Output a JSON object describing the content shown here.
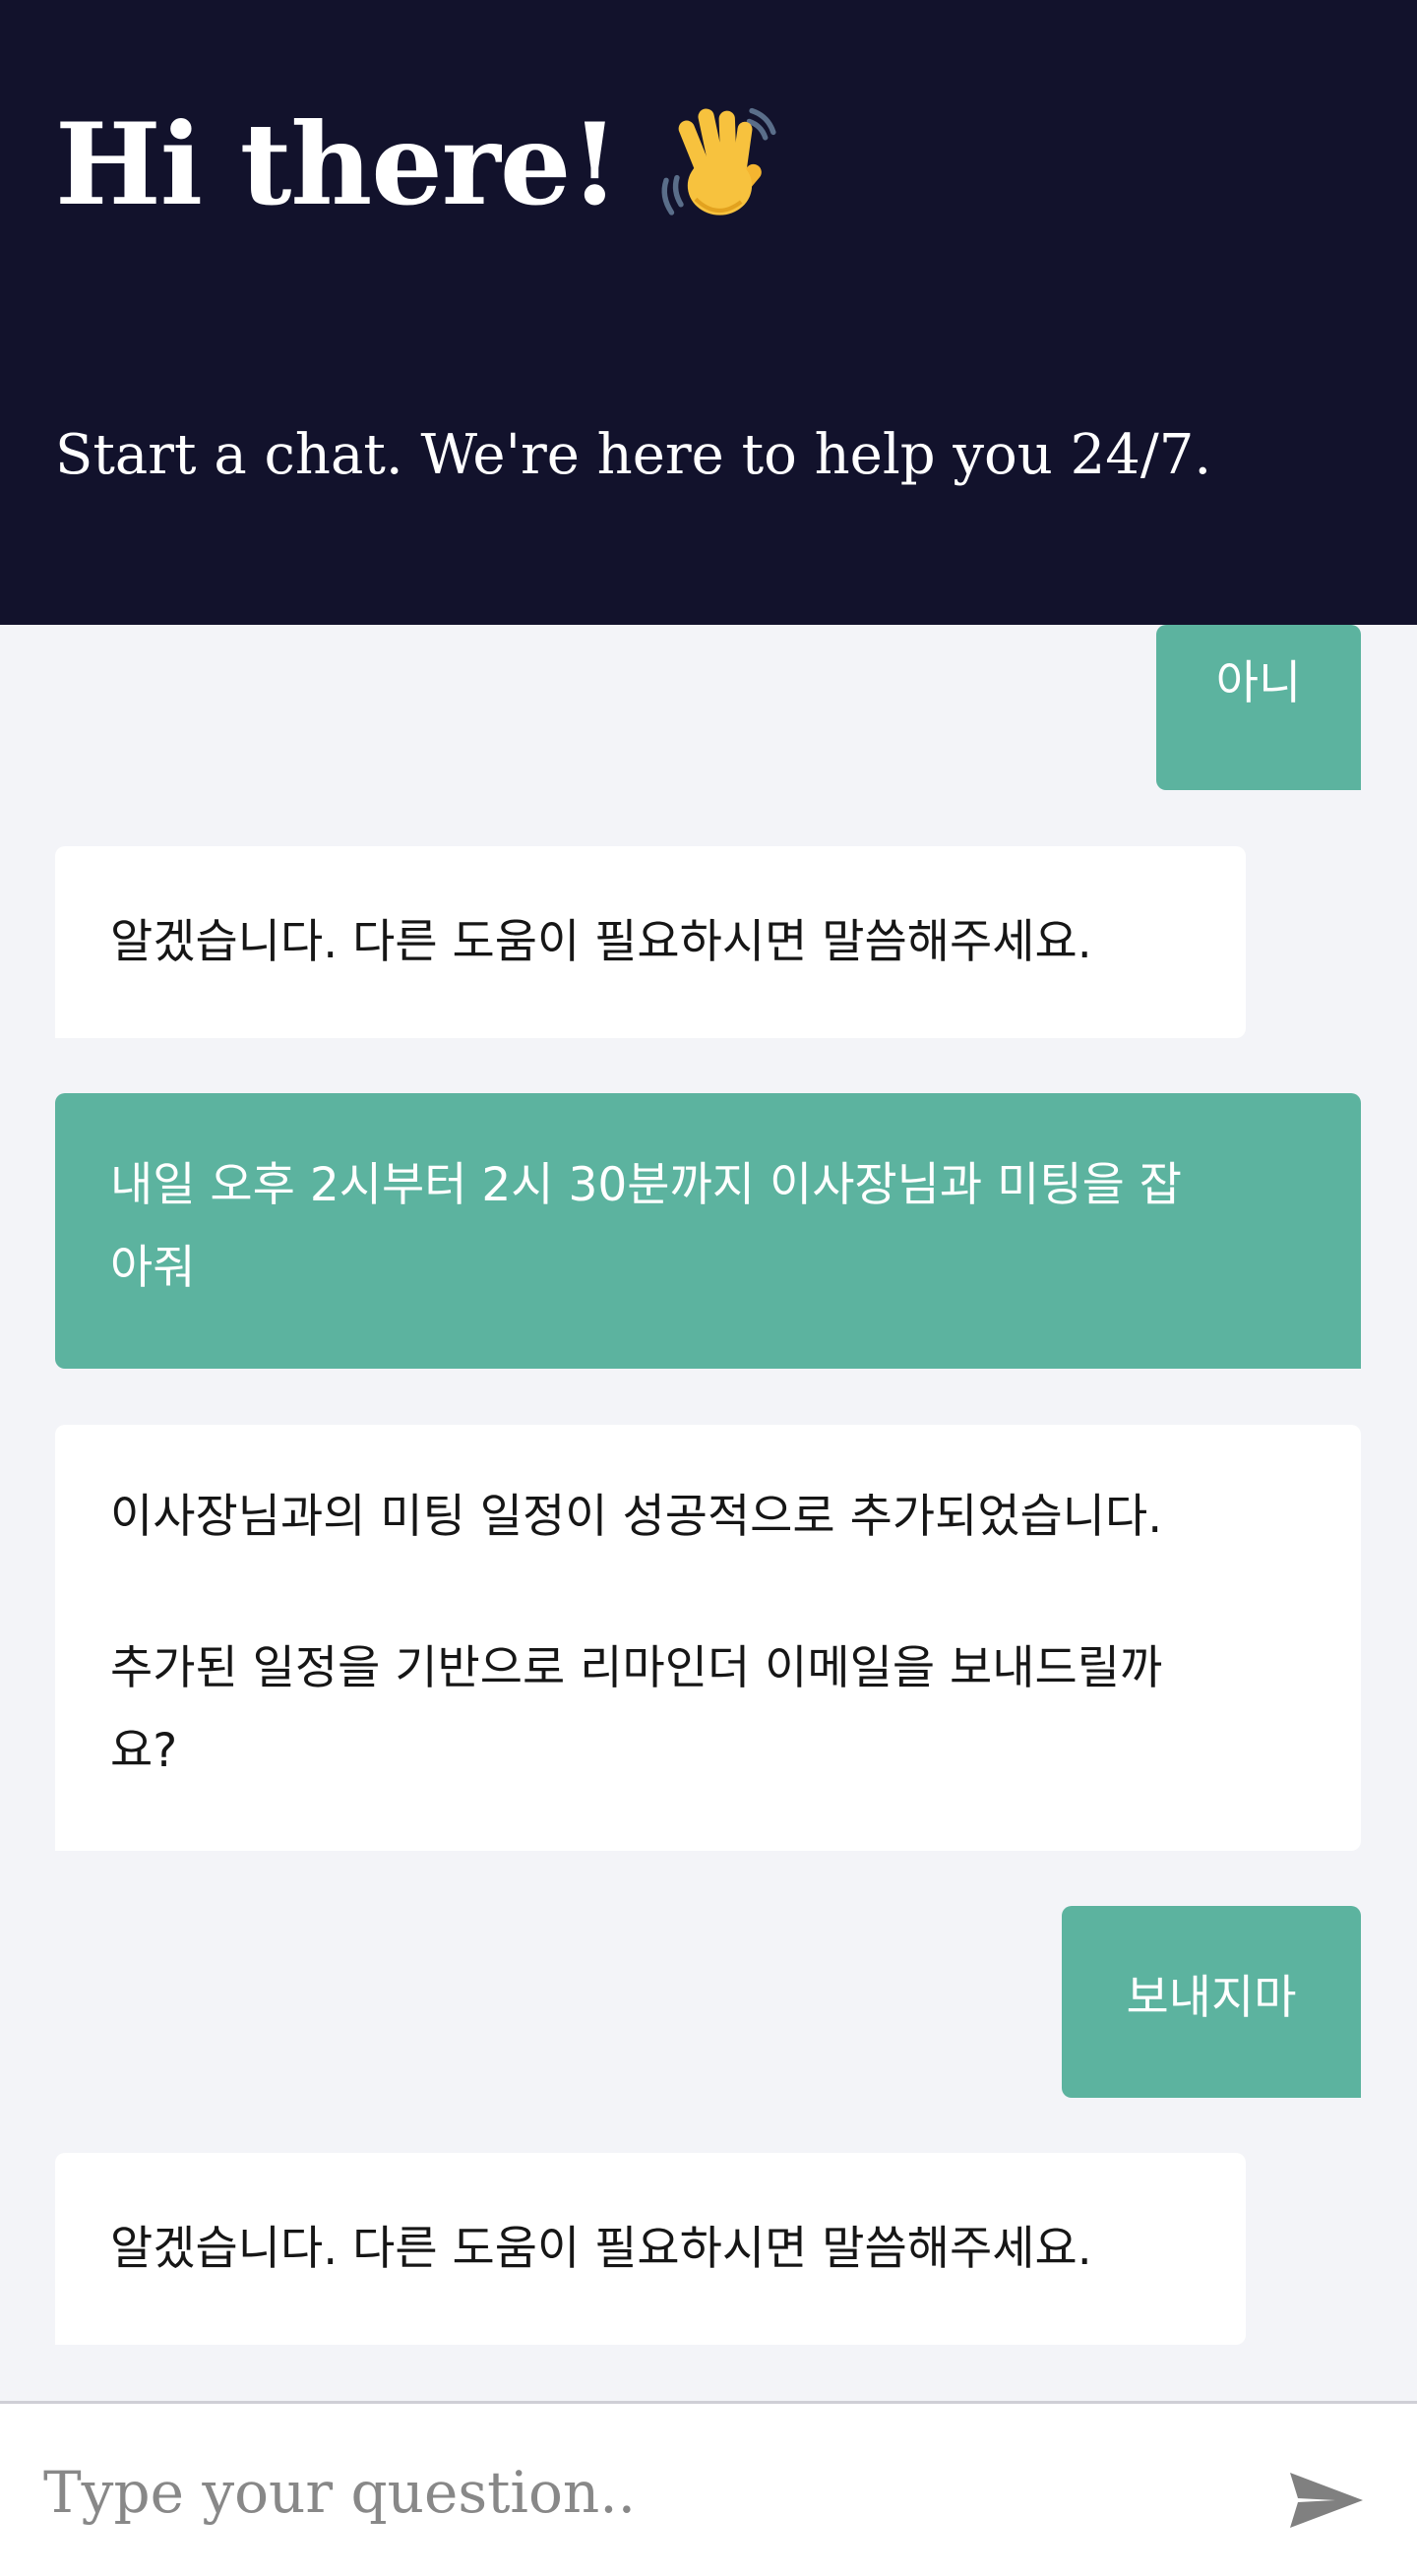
{
  "header": {
    "greeting": "Hi there!",
    "tagline": "Start a chat. We're here to help you 24/7.",
    "wave_icon": "waving-hand-icon",
    "background_color": "#12122c"
  },
  "colors": {
    "user_bubble": "#5cb39f",
    "bot_bubble": "#ffffff",
    "chat_background": "#f3f4f8"
  },
  "messages": [
    {
      "sender": "user",
      "lines": [
        "아니"
      ]
    },
    {
      "sender": "bot",
      "lines": [
        "알겠습니다. 다른 도움이 필요하시면 말씀해주세요."
      ]
    },
    {
      "sender": "user",
      "lines": [
        "내일 오후 2시부터 2시 30분까지 이사장님과 미팅을 잡",
        "아줘"
      ]
    },
    {
      "sender": "bot",
      "paragraphs": [
        [
          "이사장님과의 미팅 일정이 성공적으로 추가되었습니다."
        ],
        [
          "추가된 일정을 기반으로 리마인더 이메일을 보내드릴까",
          "요?"
        ]
      ]
    },
    {
      "sender": "user",
      "lines": [
        "보내지마"
      ]
    },
    {
      "sender": "bot",
      "lines": [
        "알겠습니다. 다른 도움이 필요하시면 말씀해주세요."
      ]
    }
  ],
  "composer": {
    "placeholder": "Type your question..",
    "value": "",
    "send_icon": "send-icon"
  }
}
